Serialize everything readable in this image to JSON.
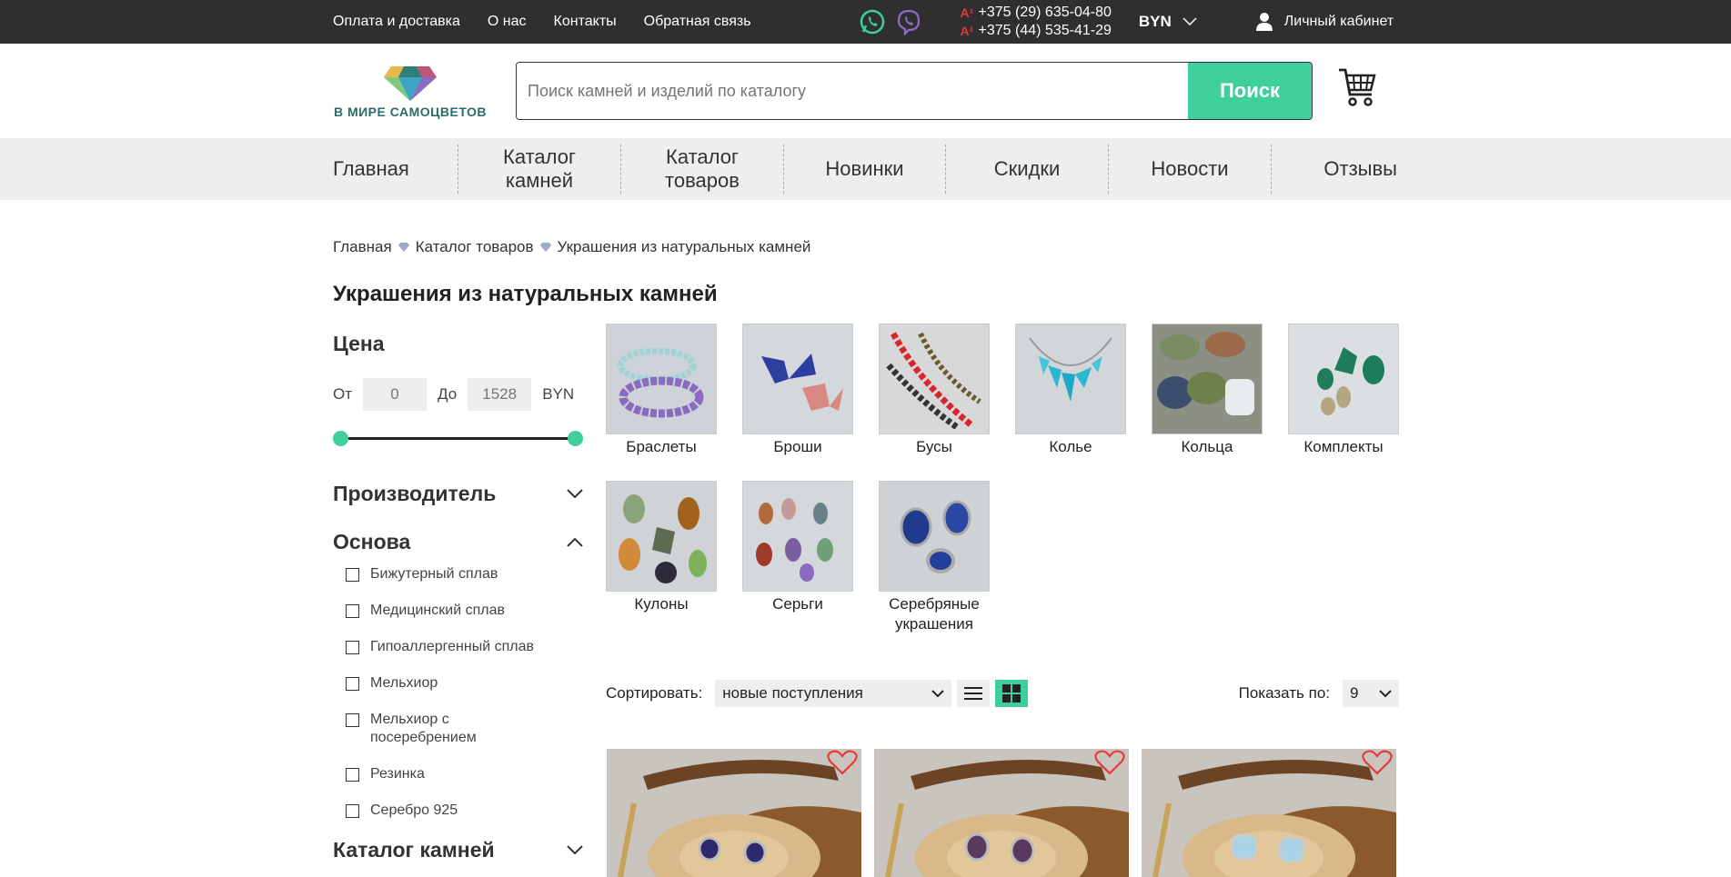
{
  "topbar": {
    "links": [
      "Оплата и доставка",
      "О нас",
      "Контакты",
      "Обратная связь"
    ],
    "phones": [
      "+375 (29) 635-04-80",
      "+375 (44) 535-41-29"
    ],
    "currency": "BYN",
    "account": "Личный кабинет"
  },
  "header": {
    "logo_text": "В МИРЕ САМОЦВЕТОВ",
    "search_placeholder": "Поиск камней и изделий по каталогу",
    "search_button": "Поиск"
  },
  "nav": {
    "items": [
      "Главная",
      "Каталог камней",
      "Каталог товаров",
      "Новинки",
      "Скидки",
      "Новости",
      "Отзывы"
    ]
  },
  "breadcrumb": [
    "Главная",
    "Каталог товаров",
    "Украшения из натуральных камней"
  ],
  "page_title": "Украшения из натуральных камней",
  "filters": {
    "price_title": "Цена",
    "from_label": "От",
    "from_value": "0",
    "to_label": "До",
    "to_value": "1528",
    "currency": "BYN",
    "manufacturer": "Производитель",
    "base": "Основа",
    "base_options": [
      "Бижутерный сплав",
      "Медицинский сплав",
      "Гипоаллергенный сплав",
      "Мельхиор",
      "Мельхиор с посеребрением",
      "Резинка",
      "Серебро 925"
    ],
    "stone_catalog": "Каталог камней"
  },
  "categories": [
    "Браслеты",
    "Броши",
    "Бусы",
    "Колье",
    "Кольца",
    "Комплекты",
    "Кулоны",
    "Серьги",
    "Серебряные украшения"
  ],
  "sort": {
    "label": "Сортировать:",
    "value": "новые поступления",
    "show_label": "Показать по:",
    "show_value": "9"
  },
  "colors": {
    "accent": "#3ecf9a",
    "topbar": "#2f2f2f",
    "heart": "#e53935"
  }
}
